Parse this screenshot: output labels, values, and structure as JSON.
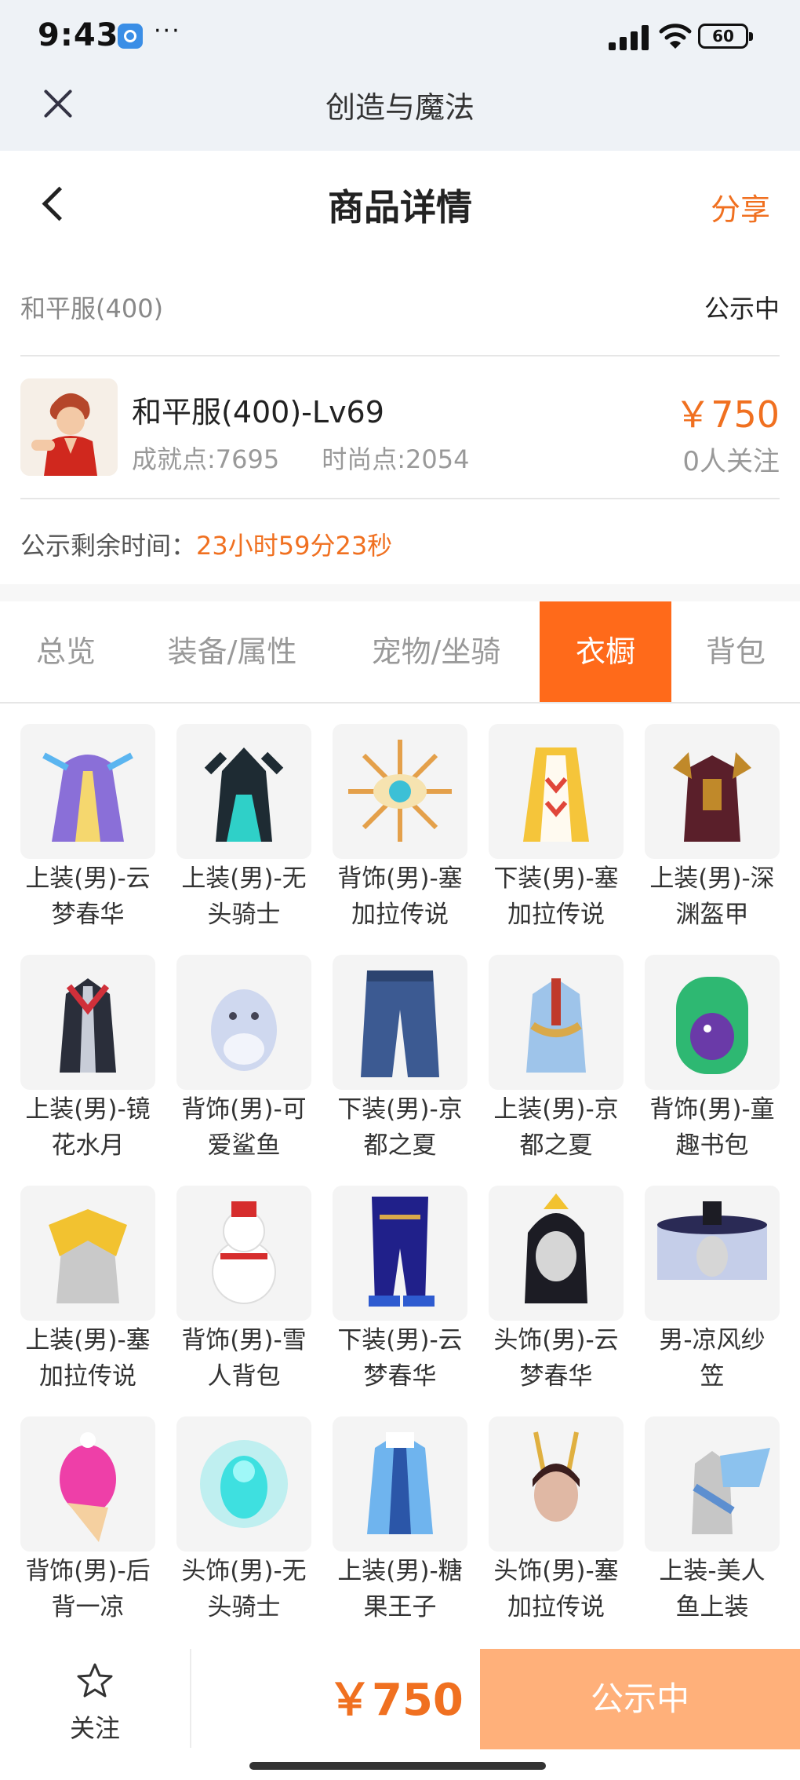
{
  "status_bar": {
    "time": "9:43",
    "more": "···",
    "battery": "60"
  },
  "window": {
    "title": "创造与魔法"
  },
  "header": {
    "title": "商品详情",
    "share_label": "分享"
  },
  "server": {
    "name": "和平服(400)",
    "status": "公示中"
  },
  "product": {
    "name": "和平服(400)-Lv69",
    "achievement": "成就点:7695",
    "fashion": "时尚点:2054",
    "price": "￥750",
    "followers": "0人关注"
  },
  "countdown": {
    "label": "公示剩余时间：",
    "value": "23小时59分23秒"
  },
  "tabs": [
    "总览",
    "装备/属性",
    "宠物/坐骑",
    "衣橱",
    "背包"
  ],
  "active_tab": "衣橱",
  "wardrobe": [
    {
      "l1": "上装(男)-云",
      "l2": "梦春华"
    },
    {
      "l1": "上装(男)-无",
      "l2": "头骑士"
    },
    {
      "l1": "背饰(男)-塞",
      "l2": "加拉传说"
    },
    {
      "l1": "下装(男)-塞",
      "l2": "加拉传说"
    },
    {
      "l1": "上装(男)-深",
      "l2": "渊盔甲"
    },
    {
      "l1": "上装(男)-镜",
      "l2": "花水月"
    },
    {
      "l1": "背饰(男)-可",
      "l2": "爱鲨鱼"
    },
    {
      "l1": "下装(男)-京",
      "l2": "都之夏"
    },
    {
      "l1": "上装(男)-京",
      "l2": "都之夏"
    },
    {
      "l1": "背饰(男)-童",
      "l2": "趣书包"
    },
    {
      "l1": "上装(男)-塞",
      "l2": "加拉传说"
    },
    {
      "l1": "背饰(男)-雪",
      "l2": "人背包"
    },
    {
      "l1": "下装(男)-云",
      "l2": "梦春华"
    },
    {
      "l1": "头饰(男)-云",
      "l2": "梦春华"
    },
    {
      "l1": "男-凉风纱",
      "l2": "笠"
    },
    {
      "l1": "背饰(男)-后",
      "l2": "背一凉"
    },
    {
      "l1": "头饰(男)-无",
      "l2": "头骑士"
    },
    {
      "l1": "上装(男)-糖",
      "l2": "果王子"
    },
    {
      "l1": "头饰(男)-塞",
      "l2": "加拉传说"
    },
    {
      "l1": "上装-美人",
      "l2": "鱼上装"
    }
  ],
  "bottom_bar": {
    "follow_label": "关注",
    "price": "￥750",
    "action_label": "公示中"
  },
  "colors": {
    "accent": "#ff6a1a",
    "price": "#f07020",
    "action_disabled": "#ffb07a"
  }
}
